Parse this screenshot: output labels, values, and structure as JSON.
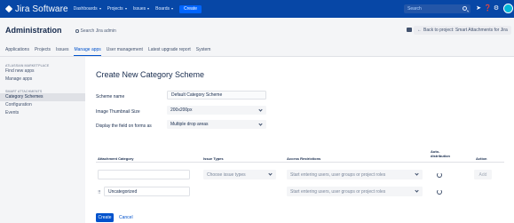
{
  "topbar": {
    "logo": "Jira Software",
    "nav": [
      {
        "label": "Dashboards"
      },
      {
        "label": "Projects"
      },
      {
        "label": "Issues"
      },
      {
        "label": "Boards"
      }
    ],
    "create_label": "Create",
    "search_placeholder": "Search",
    "icons": [
      "search-icon",
      "notifications-icon",
      "help-icon",
      "settings-icon",
      "avatar"
    ],
    "bar_color": "#0747a6"
  },
  "admin": {
    "title": "Administration",
    "search_placeholder": "Search Jira admin",
    "back_label": "Back to project: Smart Attachments for Jira",
    "tabs": [
      {
        "label": "Applications"
      },
      {
        "label": "Projects"
      },
      {
        "label": "Issues"
      },
      {
        "label": "Manage apps"
      },
      {
        "label": "User management"
      },
      {
        "label": "Latest upgrade report"
      },
      {
        "label": "System"
      }
    ],
    "active_tab": "Manage apps"
  },
  "sidebar": {
    "section1": {
      "heading": "ATLASSIAN MARKETPLACE",
      "items": [
        {
          "label": "Find new apps"
        },
        {
          "label": "Manage apps"
        }
      ]
    },
    "section2": {
      "heading": "SMART ATTACHMENTS",
      "items": [
        {
          "label": "Category Schemes"
        },
        {
          "label": "Configuration"
        },
        {
          "label": "Events"
        }
      ]
    },
    "active_item": "Category Schemes"
  },
  "form": {
    "title": "Create New Category Scheme",
    "scheme_name": {
      "label": "Scheme name",
      "value": "Default Category Scheme"
    },
    "thumbnail_size": {
      "label": "Image Thumbnail Size",
      "value": "200x200px"
    },
    "display_field": {
      "label": "Display the field on forms as",
      "value": "Multiple drop areas"
    }
  },
  "table": {
    "headers": {
      "category": "Attachment Category",
      "issue_types": "Issue Types",
      "access": "Access Restrictions",
      "auto": "Auto-distribution",
      "action": "Action"
    },
    "new_row": {
      "category_value": "",
      "issue_types_placeholder": "Choose issue types",
      "access_placeholder": "Start entering users, user groups or project roles",
      "add_label": "Add"
    },
    "rows": [
      {
        "handle": "⠿",
        "category_value": "Uncategorized",
        "access_placeholder": "Start entering users, user groups or project roles"
      }
    ]
  },
  "actions": {
    "create_label": "Create",
    "cancel_label": "Cancel"
  }
}
